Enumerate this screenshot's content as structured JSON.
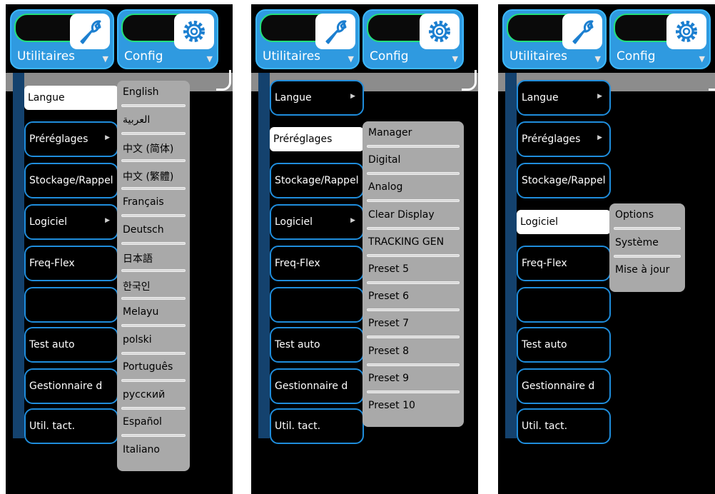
{
  "top_buttons": {
    "utilitaires": "Utilitaires",
    "config": "Config"
  },
  "panels": [
    {
      "menu": [
        {
          "label": "Langue",
          "arrow": ""
        },
        {
          "label": "Préréglages",
          "arrow": "▶"
        },
        {
          "label": "Stockage/Rappel",
          "arrow": ""
        },
        {
          "label": "Logiciel",
          "arrow": "▶"
        },
        {
          "label": "Freq-Flex",
          "arrow": ""
        },
        {
          "label": "",
          "arrow": ""
        },
        {
          "label": "Test auto",
          "arrow": ""
        },
        {
          "label": "Gestionnaire d",
          "arrow": ""
        },
        {
          "label": "Util. tact.",
          "arrow": ""
        }
      ],
      "selected": 0,
      "submenu": [
        "English",
        "العربية",
        "中文 (简体)",
        "中文 (繁體)",
        "Français",
        "Deutsch",
        "日本語",
        "한국인",
        "Melayu",
        "polski",
        "Português",
        "русский",
        "Español",
        "Italiano"
      ]
    },
    {
      "menu": [
        {
          "label": "Langue",
          "arrow": "▶"
        },
        {
          "label": "Préréglages",
          "arrow": ""
        },
        {
          "label": "Stockage/Rappel",
          "arrow": ""
        },
        {
          "label": "Logiciel",
          "arrow": "▶"
        },
        {
          "label": "Freq-Flex",
          "arrow": ""
        },
        {
          "label": "",
          "arrow": ""
        },
        {
          "label": "Test auto",
          "arrow": ""
        },
        {
          "label": "Gestionnaire d",
          "arrow": ""
        },
        {
          "label": "Util. tact.",
          "arrow": ""
        }
      ],
      "selected": 1,
      "submenu": [
        "Manager",
        "Digital",
        "Analog",
        "Clear Display",
        "TRACKING GEN",
        "Preset 5",
        "Preset 6",
        "Preset 7",
        "Preset 8",
        "Preset 9",
        "Preset 10"
      ]
    },
    {
      "menu": [
        {
          "label": "Langue",
          "arrow": "▶"
        },
        {
          "label": "Préréglages",
          "arrow": "▶"
        },
        {
          "label": "Stockage/Rappel",
          "arrow": ""
        },
        {
          "label": "Logiciel",
          "arrow": ""
        },
        {
          "label": "Freq-Flex",
          "arrow": ""
        },
        {
          "label": "",
          "arrow": ""
        },
        {
          "label": "Test auto",
          "arrow": ""
        },
        {
          "label": "Gestionnaire d",
          "arrow": ""
        },
        {
          "label": "Util. tact.",
          "arrow": ""
        }
      ],
      "selected": 3,
      "submenu": [
        "Options",
        "Système",
        "Mise à jour"
      ]
    }
  ]
}
